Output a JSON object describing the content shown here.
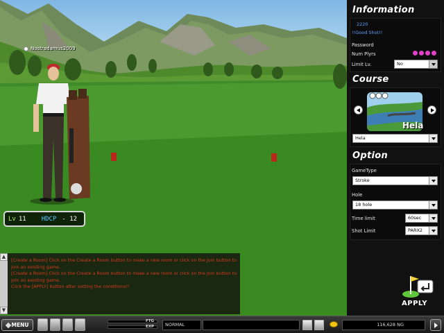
{
  "player": {
    "name": "Nostradamus2009",
    "level_label": "Lv",
    "level": "11",
    "hdcp_label": "HDCP",
    "hdcp_value": "- 12"
  },
  "chat": {
    "lines": [
      "[Create a Room] Click on the Create a Room button to make a new room or click on the Join button to join an existing game.",
      "[Create a Room] Click on the Create a Room button to make a new room or click on the Join button to join an existing game.",
      "Click the [APPLY] button after setting the conditions!!"
    ],
    "text_color": "#d43a1c"
  },
  "information": {
    "title": "Information",
    "room_number": "2220",
    "room_name": "!!Good Shot!!",
    "password_label": "Password",
    "password_value": "",
    "num_plyrs_label": "Num Plyrs",
    "num_plyrs": 4,
    "limit_lv_label": "Limit Lv.",
    "limit_lv_value": "No"
  },
  "course": {
    "title": "Course",
    "name": "Hela",
    "selected": "Hela"
  },
  "option": {
    "title": "Option",
    "gametype_label": "GameType",
    "gametype_value": "Stroke",
    "hole_label": "Hole",
    "hole_value": "18 hole",
    "time_limit_label": "Time limit",
    "time_limit_value": "60sec",
    "shot_limit_label": "Shot Limit",
    "shot_limit_value": "PARX2"
  },
  "apply_label": "APPLY",
  "bottom": {
    "menu_label": "MENU",
    "ftg_label": "FTG",
    "exp_label": "EXP",
    "ftg_fill": 0.0,
    "exp_fill": 0.0,
    "mode": "NORMAL",
    "money": "116,628 NG"
  },
  "icons": {
    "menu": "diamond-icon",
    "profile": "person-icon",
    "inventory": "bag-icon",
    "friends": "group-icon",
    "notes": "notepad-icon",
    "camera": "camera-icon",
    "settings": "gear-icon",
    "coin": "coin-icon",
    "exit": "exit-icon",
    "apply": "flag-apply-icon"
  }
}
